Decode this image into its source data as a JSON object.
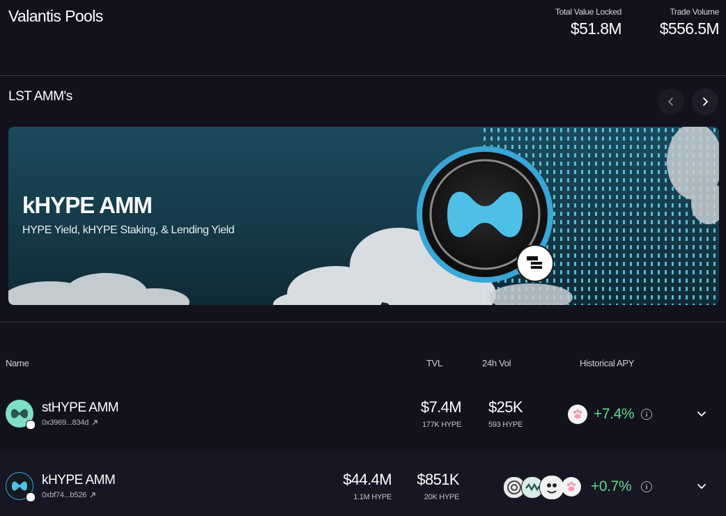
{
  "header": {
    "title": "Valantis Pools",
    "stats": [
      {
        "label": "Total Value Locked",
        "value": "$51.8M"
      },
      {
        "label": "Trade Volume",
        "value": "$556.5M"
      }
    ]
  },
  "section": {
    "title": "LST AMM's",
    "prev_icon": "chevron-left-icon",
    "next_icon": "chevron-right-icon"
  },
  "banner": {
    "title": "kHYPE AMM",
    "subtitle": "HYPE Yield, kHYPE Staking, & Lending Yield"
  },
  "table": {
    "columns": [
      "Name",
      "TVL",
      "24h Vol",
      "Historical APY"
    ],
    "rows": [
      {
        "name": "stHYPE AMM",
        "address": "0x3969...834d",
        "tvl": "$7.4M",
        "tvl_sub": "177K HYPE",
        "vol": "$25K",
        "vol_sub": "593 HYPE",
        "apy": "+7.4%"
      },
      {
        "name": "kHYPE AMM",
        "address": "0xbf74...b526",
        "tvl": "$44.4M",
        "tvl_sub": "1.1M HYPE",
        "vol": "$851K",
        "vol_sub": "20K HYPE",
        "apy": "+0.7%"
      }
    ]
  },
  "colors": {
    "background": "#12121c",
    "apy_positive": "#63d98a",
    "accent_cyan": "#5fd4e8"
  }
}
